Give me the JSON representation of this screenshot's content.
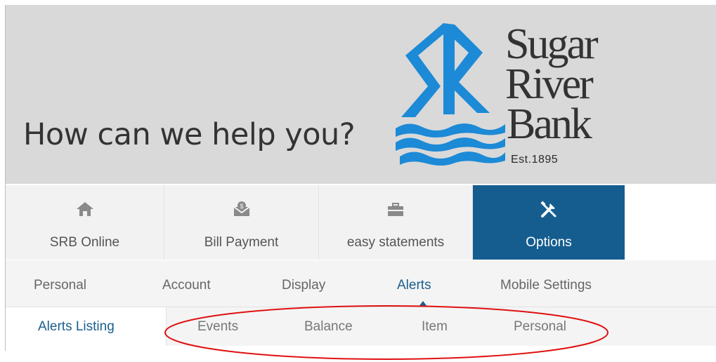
{
  "header": {
    "tagline": "How can we help you?",
    "logo": {
      "line1": "Sugar",
      "line2": "River",
      "line3": "Bank",
      "established": "Est.1895",
      "brand_color": "#1c8ad6"
    }
  },
  "main_nav": {
    "items": [
      {
        "label": "SRB Online",
        "icon": "home-icon"
      },
      {
        "label": "Bill Payment",
        "icon": "envelope-dollar-icon"
      },
      {
        "label": "easy statements",
        "icon": "briefcase-icon"
      },
      {
        "label": "Options",
        "icon": "tools-icon",
        "active": true
      }
    ],
    "active_color": "#155d8f"
  },
  "sub_nav": {
    "items": [
      {
        "label": "Personal"
      },
      {
        "label": "Account"
      },
      {
        "label": "Display"
      },
      {
        "label": "Alerts",
        "active": true
      },
      {
        "label": "Mobile Settings"
      }
    ]
  },
  "third_nav": {
    "items": [
      {
        "label": "Alerts Listing",
        "active": true
      },
      {
        "label": "Events"
      },
      {
        "label": "Balance"
      },
      {
        "label": "Item"
      },
      {
        "label": "Personal"
      }
    ]
  },
  "annotation": {
    "shape": "ellipse",
    "color": "#e01010"
  }
}
